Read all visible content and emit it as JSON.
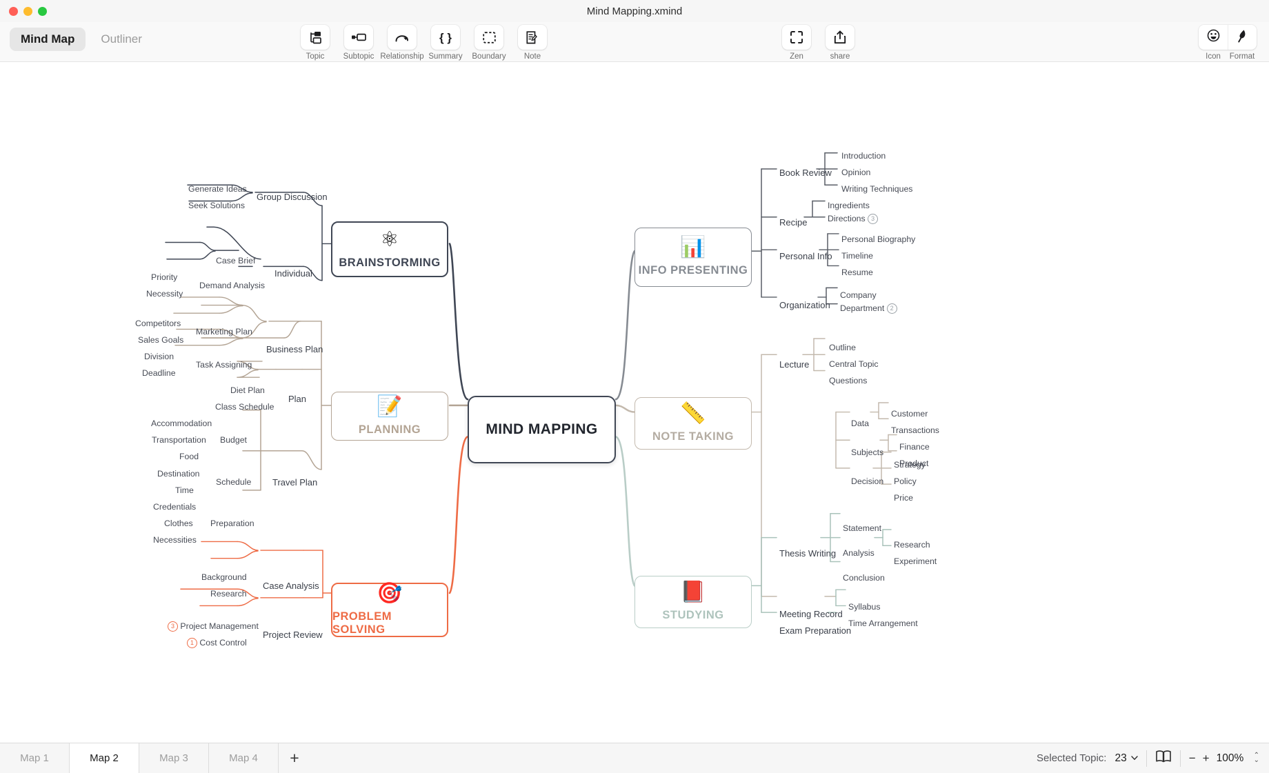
{
  "window": {
    "title": "Mind Mapping.xmind",
    "traffic_lights": [
      "close",
      "minimize",
      "zoom"
    ]
  },
  "toolbar": {
    "modes": [
      {
        "label": "Mind Map",
        "active": true
      },
      {
        "label": "Outliner",
        "active": false
      }
    ],
    "tools": [
      {
        "label": "Topic",
        "icon": "topic-icon"
      },
      {
        "label": "Subtopic",
        "icon": "subtopic-icon"
      },
      {
        "label": "Relationship",
        "icon": "relationship-icon"
      },
      {
        "label": "Summary",
        "icon": "summary-icon"
      },
      {
        "label": "Boundary",
        "icon": "boundary-icon"
      },
      {
        "label": "Note",
        "icon": "note-icon"
      }
    ],
    "zen_tools": [
      {
        "label": "Zen",
        "icon": "fullscreen-icon"
      },
      {
        "label": "share",
        "icon": "share-icon"
      }
    ],
    "right_tools": [
      {
        "label": "Icon",
        "icon": "smiley-icon"
      },
      {
        "label": "Format",
        "icon": "format-brush-icon"
      }
    ]
  },
  "statusbar": {
    "map_tabs": [
      {
        "label": "Map 1",
        "active": false
      },
      {
        "label": "Map 2",
        "active": true
      },
      {
        "label": "Map 3",
        "active": false
      },
      {
        "label": "Map 4",
        "active": false
      }
    ],
    "add_tab": "+",
    "selected_topic_label": "Selected Topic:",
    "selected_topic_count": "23",
    "zoom_level": "100%",
    "zoom_out": "−",
    "zoom_in": "+"
  },
  "mindmap": {
    "root": {
      "label": "MIND MAPPING"
    },
    "branches": [
      {
        "id": "brainstorming",
        "label": "BRAINSTORMING",
        "icon": "atom-icon",
        "color": "#3f4654",
        "side": "left",
        "children": [
          {
            "label": "Group Discussion",
            "children": [
              {
                "label": "Generate Ideas"
              },
              {
                "label": "Seek Solutions"
              }
            ]
          },
          {
            "label": "Individual",
            "children": [
              {
                "label": "Case Brief"
              },
              {
                "label": "Demand Analysis",
                "children": [
                  {
                    "label": "Priority"
                  },
                  {
                    "label": "Necessity"
                  }
                ]
              }
            ]
          }
        ]
      },
      {
        "id": "planning",
        "label": "PLANNING",
        "icon": "checklist-icon",
        "color": "#b3a494",
        "side": "left",
        "children": [
          {
            "label": "Business Plan",
            "children": [
              {
                "label": "Marketing Plan",
                "children": [
                  {
                    "label": "Competitors"
                  },
                  {
                    "label": "Sales Goals"
                  }
                ]
              },
              {
                "label": "Task Assigning",
                "children": [
                  {
                    "label": "Division"
                  },
                  {
                    "label": "Deadline"
                  }
                ]
              }
            ]
          },
          {
            "label": "Plan",
            "children": [
              {
                "label": "Diet Plan"
              },
              {
                "label": "Class Schedule"
              }
            ]
          },
          {
            "label": "Travel Plan",
            "children": [
              {
                "label": "Budget",
                "children": [
                  {
                    "label": "Accommodation"
                  },
                  {
                    "label": "Transportation"
                  },
                  {
                    "label": "Food"
                  }
                ]
              },
              {
                "label": "Schedule",
                "children": [
                  {
                    "label": "Destination"
                  },
                  {
                    "label": "Time"
                  }
                ]
              },
              {
                "label": "Preparation",
                "children": [
                  {
                    "label": "Credentials"
                  },
                  {
                    "label": "Clothes"
                  },
                  {
                    "label": "Necessities"
                  }
                ]
              }
            ]
          }
        ]
      },
      {
        "id": "problem-solving",
        "label": "PROBLEM SOLVING",
        "icon": "target-icon",
        "color": "#ee6b45",
        "side": "left",
        "children": [
          {
            "label": "Case Analysis",
            "children": [
              {
                "label": "Background"
              },
              {
                "label": "Research"
              }
            ]
          },
          {
            "label": "Project Review",
            "children": [
              {
                "label": "Project Management",
                "marker": "3"
              },
              {
                "label": "Cost Control",
                "marker": "1"
              }
            ]
          }
        ]
      },
      {
        "id": "info-presenting",
        "label": "INFO PRESENTING",
        "icon": "presentation-icon",
        "color": "#868b92",
        "side": "right",
        "children": [
          {
            "label": "Book Review",
            "children": [
              {
                "label": "Introduction"
              },
              {
                "label": "Opinion"
              },
              {
                "label": "Writing Techniques"
              }
            ]
          },
          {
            "label": "Recipe",
            "children": [
              {
                "label": "Ingredients"
              },
              {
                "label": "Directions",
                "marker": "3"
              }
            ]
          },
          {
            "label": "Personal Info",
            "children": [
              {
                "label": "Personal Biography"
              },
              {
                "label": "Timeline"
              },
              {
                "label": "Resume"
              }
            ]
          },
          {
            "label": "Organization",
            "children": [
              {
                "label": "Company"
              },
              {
                "label": "Department",
                "marker": "2"
              }
            ]
          }
        ]
      },
      {
        "id": "note-taking",
        "label": "NOTE TAKING",
        "icon": "ruler-pencil-icon",
        "color": "#b4aca2",
        "side": "right",
        "children": [
          {
            "label": "Lecture",
            "children": [
              {
                "label": "Outline"
              },
              {
                "label": "Central Topic"
              },
              {
                "label": "Questions"
              }
            ]
          },
          {
            "label": "Meeting Record",
            "children": [
              {
                "label": "Data",
                "children": [
                  {
                    "label": "Customer"
                  },
                  {
                    "label": "Transactions"
                  }
                ]
              },
              {
                "label": "Subjects",
                "children": [
                  {
                    "label": "Finance"
                  },
                  {
                    "label": "Product"
                  }
                ]
              },
              {
                "label": "Decision",
                "children": [
                  {
                    "label": "Strategy"
                  },
                  {
                    "label": "Policy"
                  },
                  {
                    "label": "Price"
                  }
                ]
              }
            ]
          }
        ]
      },
      {
        "id": "studying",
        "label": "STUDYING",
        "icon": "books-icon",
        "color": "#aec3bc",
        "side": "right",
        "children": [
          {
            "label": "Thesis Writing",
            "children": [
              {
                "label": "Statement"
              },
              {
                "label": "Analysis",
                "children": [
                  {
                    "label": "Research"
                  },
                  {
                    "label": "Experiment"
                  }
                ]
              },
              {
                "label": "Conclusion"
              }
            ]
          },
          {
            "label": "Exam Preparation",
            "children": [
              {
                "label": "Syllabus"
              },
              {
                "label": "Time Arrangement"
              }
            ]
          }
        ]
      }
    ]
  }
}
